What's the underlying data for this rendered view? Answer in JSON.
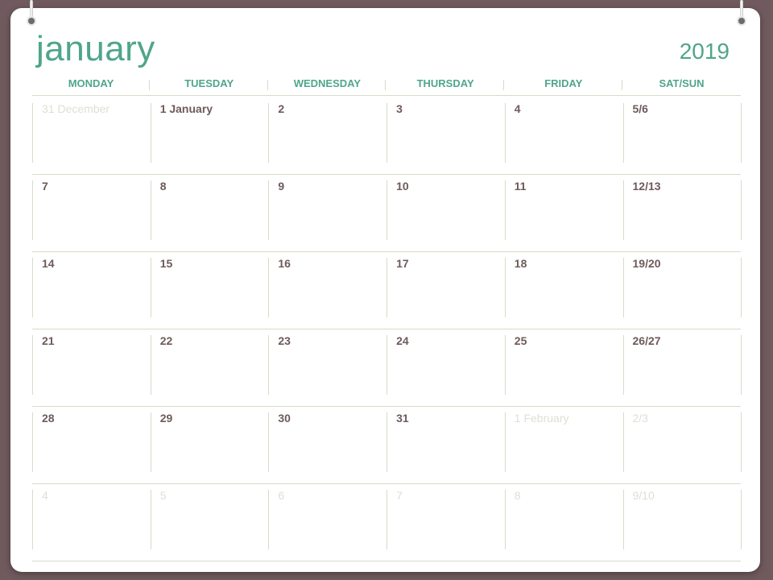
{
  "calendar": {
    "month": "january",
    "year": "2019",
    "days": [
      "MONDAY",
      "TUESDAY",
      "WEDNESDAY",
      "THURSDAY",
      "FRIDAY",
      "SAT/SUN"
    ],
    "weeks": [
      [
        {
          "label": "31 December",
          "muted": true
        },
        {
          "label": "1 January",
          "muted": false
        },
        {
          "label": "2",
          "muted": false
        },
        {
          "label": "3",
          "muted": false
        },
        {
          "label": "4",
          "muted": false
        },
        {
          "label": "5/6",
          "muted": false
        }
      ],
      [
        {
          "label": "7",
          "muted": false
        },
        {
          "label": "8",
          "muted": false
        },
        {
          "label": "9",
          "muted": false
        },
        {
          "label": "10",
          "muted": false
        },
        {
          "label": "11",
          "muted": false
        },
        {
          "label": "12/13",
          "muted": false
        }
      ],
      [
        {
          "label": "14",
          "muted": false
        },
        {
          "label": "15",
          "muted": false
        },
        {
          "label": "16",
          "muted": false
        },
        {
          "label": "17",
          "muted": false
        },
        {
          "label": "18",
          "muted": false
        },
        {
          "label": "19/20",
          "muted": false
        }
      ],
      [
        {
          "label": "21",
          "muted": false
        },
        {
          "label": "22",
          "muted": false
        },
        {
          "label": "23",
          "muted": false
        },
        {
          "label": "24",
          "muted": false
        },
        {
          "label": "25",
          "muted": false
        },
        {
          "label": "26/27",
          "muted": false
        }
      ],
      [
        {
          "label": "28",
          "muted": false
        },
        {
          "label": "29",
          "muted": false
        },
        {
          "label": "30",
          "muted": false
        },
        {
          "label": "31",
          "muted": false
        },
        {
          "label": "1 February",
          "muted": true
        },
        {
          "label": "2/3",
          "muted": true
        }
      ],
      [
        {
          "label": "4",
          "muted": true
        },
        {
          "label": "5",
          "muted": true
        },
        {
          "label": "6",
          "muted": true
        },
        {
          "label": "7",
          "muted": true
        },
        {
          "label": "8",
          "muted": true
        },
        {
          "label": "9/10",
          "muted": true
        }
      ]
    ]
  },
  "colors": {
    "background": "#705a5e",
    "accent": "#4fa58b",
    "date_text": "#6e5a5a",
    "muted_text": "#dde0d6",
    "grid_line": "#d8dbc8"
  }
}
